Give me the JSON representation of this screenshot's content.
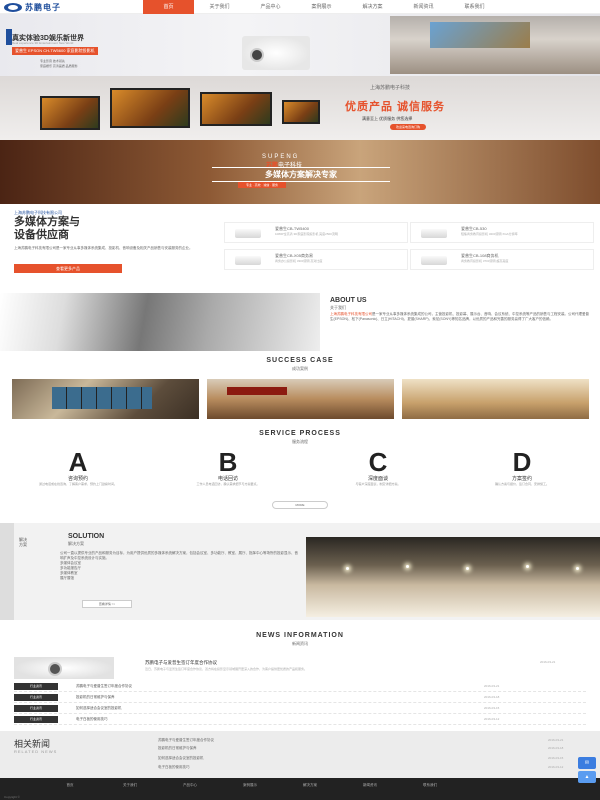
{
  "header": {
    "logo_text": "苏鹏电子",
    "nav": [
      "首页",
      "关于我们",
      "产品中心",
      "案例展示",
      "解决方案",
      "新闻资讯",
      "联系我们"
    ]
  },
  "banner1": {
    "title": "真实体验3D娱乐新世界",
    "subtitle": "Real experience 3D Entertainment New World",
    "red_tag": "爱普生 EPSON CH-TW5600 家庭影院投影机",
    "small_lines": [
      "专业影音 技术领先",
      "家庭娱乐 高清画质 品质服务"
    ]
  },
  "banner2": {
    "company": "上海苏鹏电子科技",
    "slogan": "优质产品 诚信服务",
    "sub": "满意至上 优质服务 供您选择",
    "button": "欢迎来电咨询订购"
  },
  "banner3": {
    "en": "SUPENG",
    "cn_brand": "苏鹏",
    "cn_rest": "电子科技",
    "title": "多媒体方案解决专家",
    "tag": "专业 · 高效 · 诚信 · 服务"
  },
  "intro": {
    "small": "上海苏鹏电子科技有限公司",
    "big_line1": "多媒体方案与",
    "big_line2": "设备供应商",
    "text": "上海苏鹏电子科技有限公司是一家专业从事多媒体系统集成、投影机、音响设备及相关产品销售与安装服务的企业。",
    "button": "查看更多产品"
  },
  "products": [
    {
      "name": "爱普生CB-TW5400",
      "desc": "1080P全高清 3D家庭影院投影机 亮度2500流明"
    },
    {
      "name": "爱普生CB-530",
      "desc": "短焦商务教育投影机 3200流明 XGA分辨率"
    },
    {
      "name": "爱普生CB-X05商务易",
      "desc": "商务办公投影机 3300流明 高对比度"
    },
    {
      "name": "爱普生CB-108商务机",
      "desc": "商务教育投影机 3700流明 超高亮度"
    }
  ],
  "about": {
    "en": "ABOUT US",
    "cn": "关于我们",
    "highlight": "上海苏鹏电子科技有限公司",
    "text": "是一家专业从事多媒体系统集成的公司，主营投影机、投影幕、展示台、音响、会议系统、中控系统等产品的销售与工程安装。公司代理爱普生(EPSON)、松下(Panasonic)、日立(HITACHI)、夏普(SHARP)、索尼(SONY)等知名品牌，以优质的产品和完善的服务赢得了广大客户的信赖。"
  },
  "success": {
    "en": "SUCCESS CASE",
    "cn": "成功案例"
  },
  "service": {
    "en": "SERVICE PROCESS",
    "cn": "服务流程",
    "steps": [
      {
        "letter": "A",
        "title": "咨询预约",
        "desc": "通过电话或在线咨询，了解客户需求，预约上门勘察时间。"
      },
      {
        "letter": "B",
        "title": "电话回访",
        "desc": "工作人员电话回访，确认需求细节与方案要点。"
      },
      {
        "letter": "C",
        "title": "深度面谈",
        "desc": "与客户深度面谈，制定详细方案。"
      },
      {
        "letter": "D",
        "title": "方案签约",
        "desc": "确认方案与报价，签订合同，安排施工。"
      }
    ],
    "more": "MORE"
  },
  "solution": {
    "side": "解决方案",
    "en": "SOLUTION",
    "cn": "解决方案",
    "text": "公司一直以提供专业的产品和服务为目标，为用户提供优质的多媒体系统解决方案，包括会议室、多功能厅、教室、展厅、指挥中心等场所的投影显示、音响扩声及中控系统设计与实施。",
    "list": [
      "多媒体会议室",
      "多功能报告厅",
      "多媒体教室",
      "展厅展馆"
    ],
    "button": "查看详情 >>"
  },
  "news": {
    "en": "NEWS INFORMATION",
    "cn": "新闻资讯",
    "featured_title": "苏鹏电子与爱普生签订年度合作协议",
    "featured_date": "2016-03-21",
    "featured_desc": "近日，苏鹏电子与爱普生签订年度合作协议，双方将在投影显示领域展开更深入的合作，为客户提供更优质的产品和服务。",
    "rows": [
      {
        "tag": "行业资讯",
        "title": "苏鹏电子与爱普生签订年度合作协议",
        "date": "2016-03-21"
      },
      {
        "tag": "行业资讯",
        "title": "投影机的日常维护与保养",
        "date": "2016-03-18"
      },
      {
        "tag": "行业资讯",
        "title": "如何选择适合会议室的投影机",
        "date": "2016-03-15"
      },
      {
        "tag": "行业资讯",
        "title": "电子白板的使用技巧",
        "date": "2016-03-12"
      }
    ]
  },
  "related": {
    "cn": "相关新闻",
    "en": "RELATED NEWS",
    "items": [
      {
        "title": "苏鹏电子与爱普生签订年度合作协议",
        "date": "2016-03-21"
      },
      {
        "title": "投影机的日常维护与保养",
        "date": "2016-03-18"
      },
      {
        "title": "如何选择适合会议室的投影机",
        "date": "2016-03-15"
      },
      {
        "title": "电子白板的使用技巧",
        "date": "2016-03-12"
      }
    ]
  },
  "footer": {
    "nav": [
      "首页",
      "关于我们",
      "产品中心",
      "案例展示",
      "解决方案",
      "新闻资讯",
      "联系我们"
    ],
    "copyright": "Copyright ©"
  },
  "float": {
    "qq_icon": "qq-icon",
    "top_icon": "arrow-up-icon"
  }
}
